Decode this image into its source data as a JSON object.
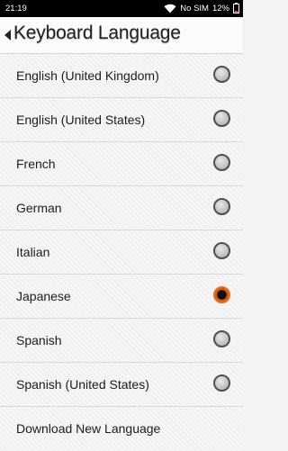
{
  "status_bar": {
    "time": "21:19",
    "network": "No SIM",
    "battery": "12%"
  },
  "header": {
    "title": "Keyboard Language"
  },
  "languages": [
    {
      "label": "English (United Kingdom)",
      "selected": false
    },
    {
      "label": "English (United States)",
      "selected": false
    },
    {
      "label": "French",
      "selected": false
    },
    {
      "label": "German",
      "selected": false
    },
    {
      "label": "Italian",
      "selected": false
    },
    {
      "label": "Japanese",
      "selected": true
    },
    {
      "label": "Spanish",
      "selected": false
    },
    {
      "label": "Spanish (United States)",
      "selected": false
    }
  ],
  "download": {
    "label": "Download New Language"
  },
  "colors": {
    "accent": "#ef6a1f",
    "status_bar": "#000000"
  },
  "icons": [
    "wifi-icon",
    "battery-icon",
    "back-arrow-icon",
    "radio-button-icon"
  ]
}
